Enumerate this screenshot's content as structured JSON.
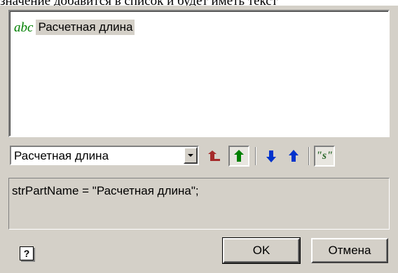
{
  "doc_text": "значение добавится в список и будет иметь текст",
  "list": {
    "items": [
      {
        "icon": "abc-icon",
        "icon_text": "abc",
        "label": "Расчетная длина"
      }
    ]
  },
  "combo": {
    "value": "Расчетная длина"
  },
  "toolbar": {
    "buttons": [
      {
        "name": "move-down-red-button",
        "icon": "arrow-down-red-icon",
        "color": "#a52a2a"
      },
      {
        "name": "move-up-green-button",
        "icon": "arrow-up-green-icon",
        "color": "#008000"
      },
      {
        "name": "move-down-blue-button",
        "icon": "arrow-down-blue-icon",
        "color": "#0033cc"
      },
      {
        "name": "move-up-blue-button",
        "icon": "arrow-up-blue-icon",
        "color": "#0033cc"
      },
      {
        "name": "string-mode-button",
        "icon": "string-s-icon",
        "icon_text": "\"s\""
      }
    ]
  },
  "code": {
    "text": "strPartName = \"Расчетная длина\";"
  },
  "buttons": {
    "ok": "OK",
    "cancel": "Отмена"
  },
  "help": {
    "icon": "help-icon",
    "glyph": "?"
  }
}
